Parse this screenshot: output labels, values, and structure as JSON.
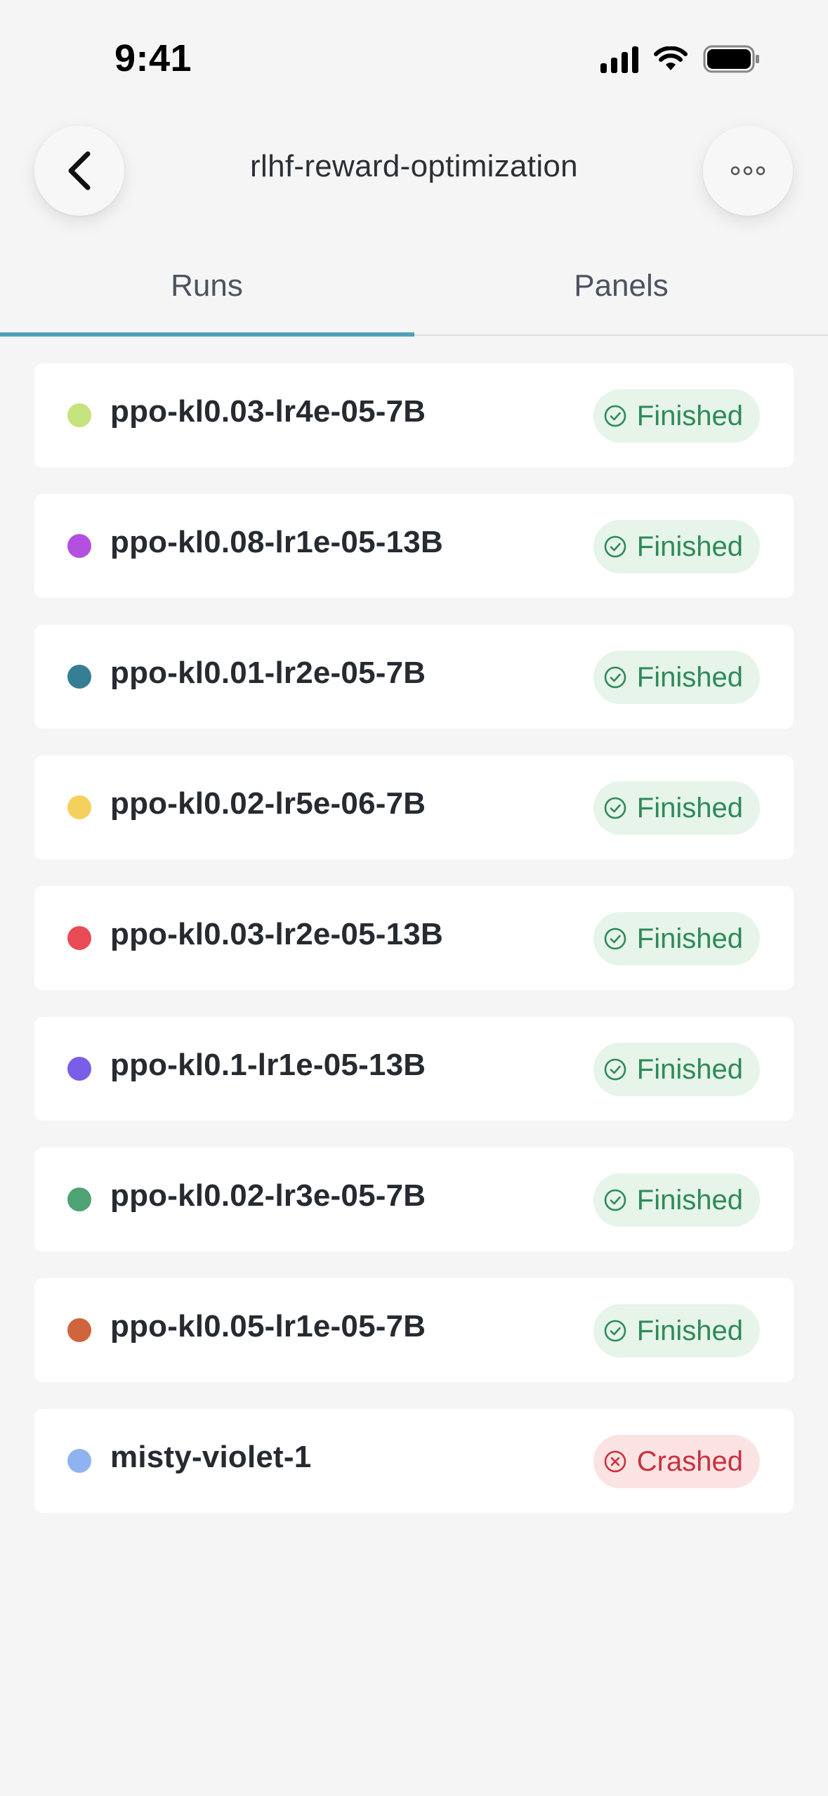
{
  "status_bar": {
    "time": "9:41"
  },
  "header": {
    "title": "rlhf-reward-optimization",
    "back_icon": "chevron-left-icon",
    "more_icon": "ellipsis-icon"
  },
  "tabs": [
    {
      "label": "Runs",
      "active": true
    },
    {
      "label": "Panels",
      "active": false
    }
  ],
  "colors": {
    "accent": "#4fa1b6",
    "finished_bg": "#e6f4ea",
    "finished_text": "#2f8a57",
    "crashed_bg": "#fbe3e3",
    "crashed_text": "#c8313d"
  },
  "runs": [
    {
      "name": "ppo-kl0.03-lr4e-05-7B",
      "color": "#c5e37e",
      "status": "Finished"
    },
    {
      "name": "ppo-kl0.08-lr1e-05-13B",
      "color": "#b44fe0",
      "status": "Finished"
    },
    {
      "name": "ppo-kl0.01-lr2e-05-7B",
      "color": "#367e93",
      "status": "Finished"
    },
    {
      "name": "ppo-kl0.02-lr5e-06-7B",
      "color": "#f6d05c",
      "status": "Finished"
    },
    {
      "name": "ppo-kl0.03-lr2e-05-13B",
      "color": "#e84a56",
      "status": "Finished"
    },
    {
      "name": "ppo-kl0.1-lr1e-05-13B",
      "color": "#7a5ee8",
      "status": "Finished"
    },
    {
      "name": "ppo-kl0.02-lr3e-05-7B",
      "color": "#4ea372",
      "status": "Finished"
    },
    {
      "name": "ppo-kl0.05-lr1e-05-7B",
      "color": "#d0643d",
      "status": "Finished"
    },
    {
      "name": "misty-violet-1",
      "color": "#8fb3f0",
      "status": "Crashed"
    }
  ]
}
